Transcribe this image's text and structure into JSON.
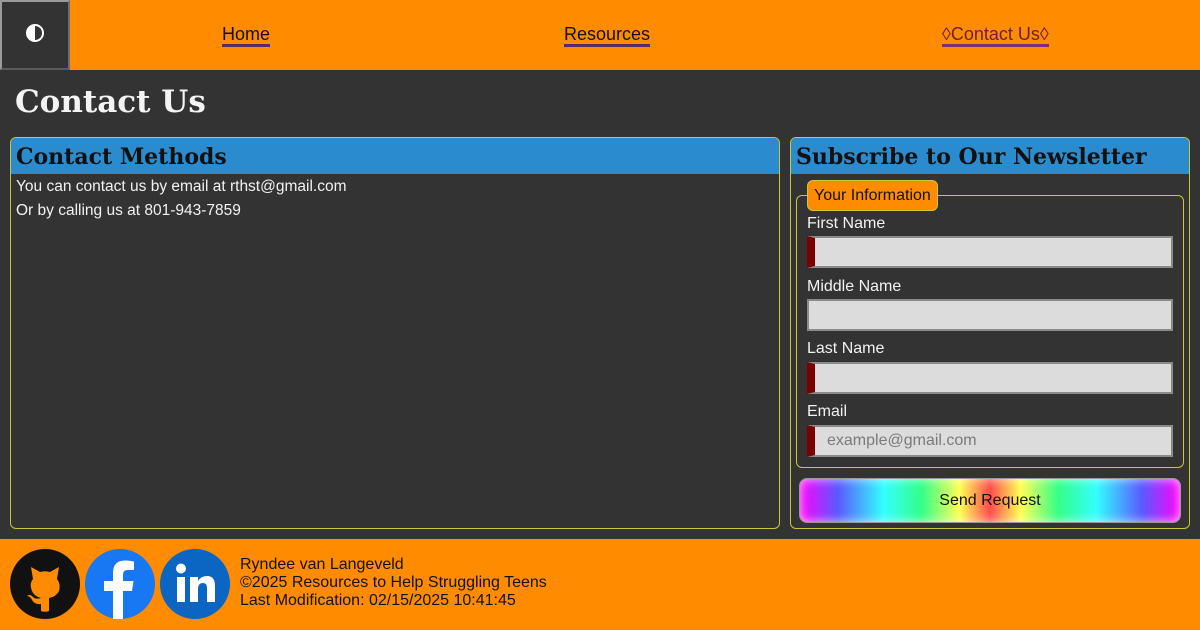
{
  "nav": {
    "theme_toggle_icon": "contrast-icon",
    "links": [
      {
        "label": "Home"
      },
      {
        "label": "Resources"
      },
      {
        "label": "◊Contact Us◊",
        "active": true
      }
    ],
    "colors": {
      "bar": "#ff8c00",
      "toggle_bg": "#333333"
    }
  },
  "page": {
    "title": "Contact Us"
  },
  "contact": {
    "heading": "Contact Methods",
    "lines": [
      "You can contact us by email at rthst@gmail.com",
      "Or by calling us at 801-943-7859"
    ]
  },
  "newsletter": {
    "heading": "Subscribe to Our Newsletter",
    "legend": "Your Information",
    "fields": [
      {
        "label": "First Name",
        "value": "",
        "placeholder": "",
        "required": true
      },
      {
        "label": "Middle Name",
        "value": "",
        "placeholder": "",
        "required": false
      },
      {
        "label": "Last Name",
        "value": "",
        "placeholder": "",
        "required": true
      },
      {
        "label": "Email",
        "value": "",
        "placeholder": "example@gmail.com",
        "required": true
      }
    ],
    "submit_label": "Send Request"
  },
  "footer": {
    "social": [
      {
        "name": "github-icon"
      },
      {
        "name": "facebook-icon"
      },
      {
        "name": "linkedin-icon"
      }
    ],
    "author": "Ryndee van Langeveld",
    "copyright": "©2025 Resources to Help Struggling Teens",
    "modified": "Last Modification: 02/15/2025 10:41:45"
  },
  "colors": {
    "accent_orange": "#ff8c00",
    "panel_header_blue": "#2a8ccf",
    "background": "#333333",
    "panel_border": "#c8c83a",
    "required_marker": "#7a0000"
  }
}
